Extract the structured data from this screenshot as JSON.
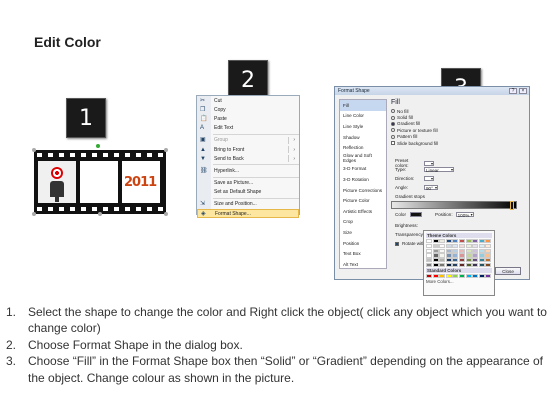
{
  "title": "Edit Color",
  "steps_markers": [
    "1",
    "2",
    "3"
  ],
  "film_year": "2011",
  "context_menu": {
    "items": [
      {
        "label": "Cut",
        "icon": "scissors-icon",
        "glyph": "✂",
        "disabled": false
      },
      {
        "label": "Copy",
        "icon": "copy-icon",
        "glyph": "❐",
        "disabled": false
      },
      {
        "label": "Paste",
        "icon": "paste-icon",
        "glyph": "📋",
        "disabled": false
      },
      {
        "label": "Edit Text",
        "icon": "edit-text-icon",
        "glyph": "A",
        "disabled": false
      },
      {
        "label": "Group",
        "icon": "group-icon",
        "glyph": "▣",
        "disabled": true,
        "submenu": true
      },
      {
        "label": "Bring to Front",
        "icon": "bring-front-icon",
        "glyph": "▲",
        "disabled": false,
        "submenu": true
      },
      {
        "label": "Send to Back",
        "icon": "send-back-icon",
        "glyph": "▼",
        "disabled": false,
        "submenu": true
      },
      {
        "label": "Hyperlink...",
        "icon": "hyperlink-icon",
        "glyph": "⛓",
        "disabled": false
      },
      {
        "label": "Save as Picture...",
        "icon": "",
        "glyph": "",
        "disabled": false
      },
      {
        "label": "Set as Default Shape",
        "icon": "",
        "glyph": "",
        "disabled": false
      },
      {
        "label": "Size and Position...",
        "icon": "size-icon",
        "glyph": "⇲",
        "disabled": false
      },
      {
        "label": "Format Shape...",
        "icon": "format-shape-icon",
        "glyph": "◈",
        "disabled": false,
        "highlighted": true
      }
    ]
  },
  "dialog": {
    "title": "Format Shape",
    "categories": [
      "Fill",
      "Line Color",
      "Line Style",
      "Shadow",
      "Reflection",
      "Glow and Soft Edges",
      "3-D Format",
      "3-D Rotation",
      "Picture Corrections",
      "Picture Color",
      "Artistic Effects",
      "Crop",
      "Size",
      "Position",
      "Text Box",
      "Alt Text"
    ],
    "selected_category": "Fill",
    "panel_heading": "Fill",
    "fill_options": [
      {
        "label": "No fill",
        "checked": false
      },
      {
        "label": "Solid fill",
        "checked": false
      },
      {
        "label": "Gradient fill",
        "checked": true
      },
      {
        "label": "Picture or texture fill",
        "checked": false
      },
      {
        "label": "Pattern fill",
        "checked": false
      }
    ],
    "slide_background_fill": "Slide background fill",
    "preset_colors_label": "Preset colors:",
    "type_label": "Type:",
    "type_value": "Linear",
    "direction_label": "Direction:",
    "angle_label": "Angle:",
    "angle_value": "90°",
    "gradient_stops_label": "Gradient stops",
    "color_label": "Color",
    "position_label": "Position:",
    "position_value": "100%",
    "brightness_label": "Brightness:",
    "transparency_label": "Transparency:",
    "rotate_label": "Rotate with shape",
    "close_label": "Close",
    "palette": {
      "theme_colors_label": "Theme Colors",
      "standard_colors_label": "Standard Colors",
      "more_colors_label": "More Colors...",
      "theme_top": [
        "#ffffff",
        "#000000",
        "#eeece1",
        "#1f497d",
        "#4f81bd",
        "#c0504d",
        "#9bbb59",
        "#8064a2",
        "#4bacc6",
        "#f79646"
      ],
      "standard": [
        "#c00000",
        "#ff0000",
        "#ffc000",
        "#ffff00",
        "#92d050",
        "#00b050",
        "#00b0f0",
        "#0070c0",
        "#002060",
        "#7030a0"
      ]
    }
  },
  "instructions": [
    {
      "num": "1.",
      "text": "Select the shape to change the color and Right click the object( click any object which you want to change color)"
    },
    {
      "num": "2.",
      "text": "Choose Format Shape in the dialog box."
    },
    {
      "num": "3.",
      "text": "Choose “Fill” in the Format Shape box then “Solid” or “Gradient” depending on the appearance of the object. Change colour as shown in the picture."
    }
  ]
}
